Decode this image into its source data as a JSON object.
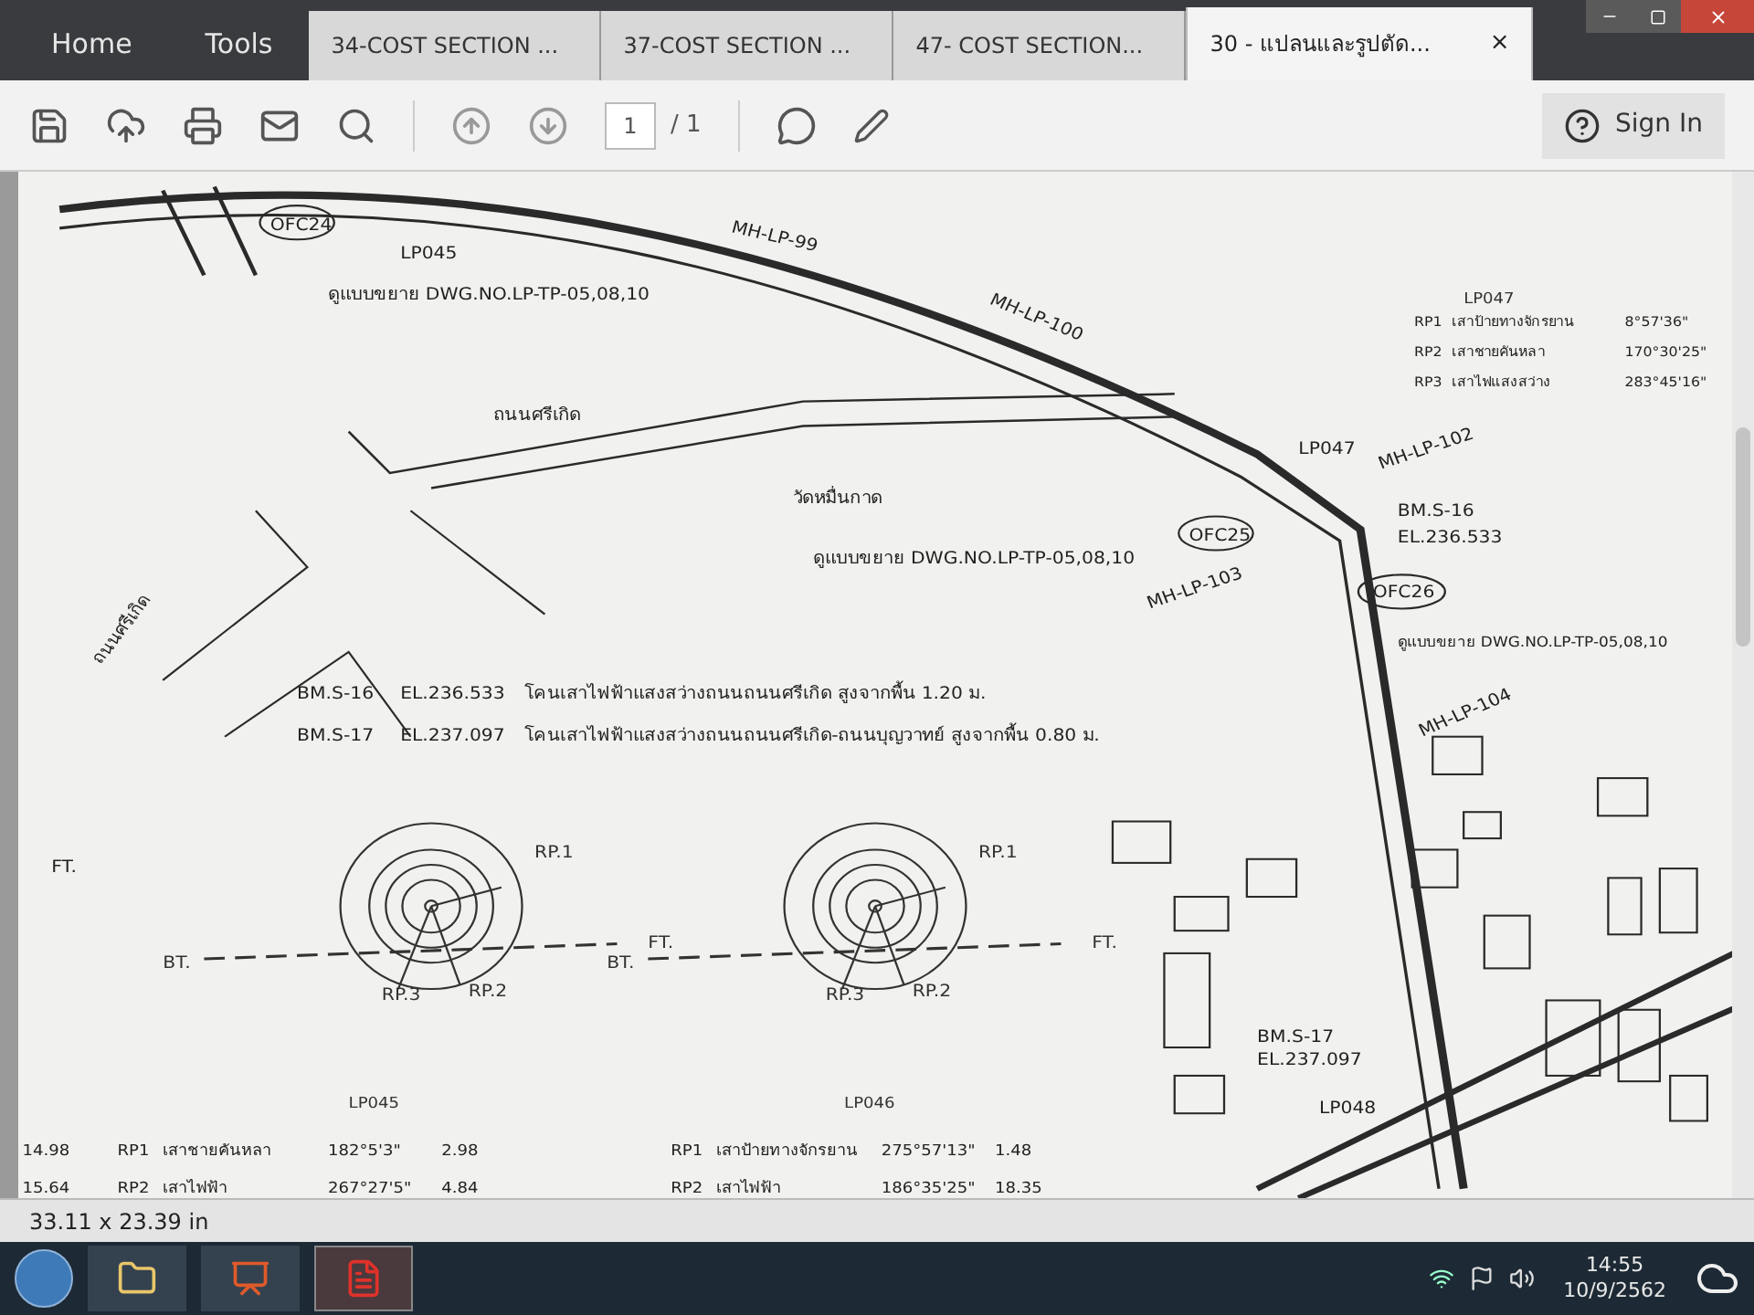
{
  "app_tabs": [
    {
      "label": "Home"
    },
    {
      "label": "Tools"
    }
  ],
  "doc_tabs": [
    {
      "label": "34-COST SECTION ...",
      "selected": false
    },
    {
      "label": "37-COST SECTION ...",
      "selected": false
    },
    {
      "label": "47- COST SECTION...",
      "selected": false
    },
    {
      "label": "30 - แปลนและรูปตัด...",
      "selected": true,
      "close": "×"
    }
  ],
  "sign_in": "Sign In",
  "page": {
    "value": "1",
    "total": "/ 1"
  },
  "drawing": {
    "labels": [
      "LP045",
      "OFC24",
      "ดูแบบขยาย DWG.NO.LP-TP-05,08,10",
      "MH-LP-99",
      "MH-LP-100",
      "ถนนศรีเกิด",
      "วัดหมื่นกาด",
      "ถนนศรีเกิด",
      "ดูแบบขยาย DWG.NO.LP-TP-05,08,10",
      "OFC25",
      "LP047",
      "MH-LP-102",
      "BM.S-16",
      "EL.236.533",
      "MH-LP-103",
      "OFC26",
      "ดูแบบขยาย DWG.NO.LP-TP-05,08,10",
      "MH-LP-104",
      "BM.S-17",
      "EL.237.097",
      "LP048",
      "FT."
    ],
    "legend": {
      "title": "LP047",
      "rows": [
        {
          "code": "RP1",
          "name": "เสาป้ายทางจักรยาน",
          "angle": "8°57'36\""
        },
        {
          "code": "RP2",
          "name": "เสาชายคันหลา",
          "angle": "170°30'25\""
        },
        {
          "code": "RP3",
          "name": "เสาไฟแสงสว่าง",
          "angle": "283°45'16\""
        }
      ]
    },
    "notes": [
      {
        "mark": "BM.S-16",
        "el": "EL.236.533",
        "text": "โคนเสาไฟฟ้าแสงสว่างถนนถนนศรีเกิด สูงจากพื้น 1.20 ม."
      },
      {
        "mark": "BM.S-17",
        "el": "EL.237.097",
        "text": "โคนเสาไฟฟ้าแสงสว่างถนนถนนศรีเกิด-ถนนบุญวาทย์ สูงจากพื้น 0.80 ม."
      }
    ],
    "diagrams": [
      {
        "labels": [
          "RP.1",
          "RP.2",
          "RP.3",
          "BT.",
          "FT."
        ]
      },
      {
        "labels": [
          "RP.1",
          "RP.2",
          "RP.3",
          "BT.",
          "FT."
        ]
      }
    ],
    "tables": [
      {
        "title": "LP045",
        "rows": [
          {
            "lead": "14.98",
            "code": "RP1",
            "name": "เสาชายคันหลา",
            "angle": "182°5'3\"",
            "dist": "2.98"
          },
          {
            "lead": "15.64",
            "code": "RP2",
            "name": "เสาไฟฟ้า",
            "angle": "267°27'5\"",
            "dist": "4.84"
          }
        ]
      },
      {
        "title": "LP046",
        "rows": [
          {
            "code": "RP1",
            "name": "เสาป้ายทางจักรยาน",
            "angle": "275°57'13\"",
            "dist": "1.48"
          },
          {
            "code": "RP2",
            "name": "เสาไฟฟ้า",
            "angle": "186°35'25\"",
            "dist": "18.35"
          }
        ]
      }
    ]
  },
  "status": {
    "size": "33.11 x 23.39 in"
  },
  "taskbar": {
    "time": "14:55",
    "date": "10/9/2562"
  }
}
